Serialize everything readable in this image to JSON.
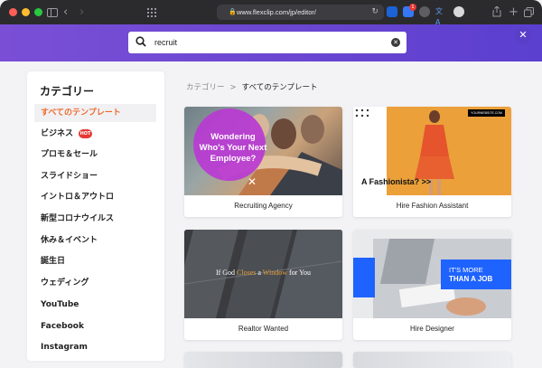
{
  "browser": {
    "url": "www.flexclip.com/jp/editor/",
    "shield_badge": "1"
  },
  "header": {
    "search_value": "recruit"
  },
  "sidebar": {
    "title": "カテゴリー",
    "hot_badge": "HOT",
    "items": [
      {
        "label": "すべてのテンプレート"
      },
      {
        "label": "ビジネス"
      },
      {
        "label": "プロモ＆セール"
      },
      {
        "label": "スライドショー"
      },
      {
        "label": "イントロ＆アウトロ"
      },
      {
        "label": "新型コロナウイルス"
      },
      {
        "label": "休み＆イベント"
      },
      {
        "label": "誕生日"
      },
      {
        "label": "ウェディング"
      },
      {
        "label": "YouTube"
      },
      {
        "label": "Facebook"
      },
      {
        "label": "Instagram"
      }
    ]
  },
  "breadcrumb": {
    "root": "カテゴリー",
    "separator": ">",
    "current": "すべてのテンプレート"
  },
  "templates": [
    {
      "label": "Recruiting Agency",
      "overlay": "Wondering Who's Your Next Employee?"
    },
    {
      "label": "Hire Fashion Assistant",
      "overlay": "A Fashionista? >>",
      "tag": "YOURWEBSITE.COM"
    },
    {
      "label": "Realtor Wanted",
      "overlay_pre": "If God ",
      "overlay_mid1": "Closes",
      "overlay_mid2": " a ",
      "overlay_mid3": "Window",
      "overlay_post": " for You"
    },
    {
      "label": "Hire Designer",
      "overlay_line1": "IT'S MORE",
      "overlay_line2": "THAN A JOB"
    }
  ],
  "colors": {
    "accent_orange": "#ee6a2c",
    "header_purple": "#6a46d1",
    "hot_red": "#e53935"
  }
}
